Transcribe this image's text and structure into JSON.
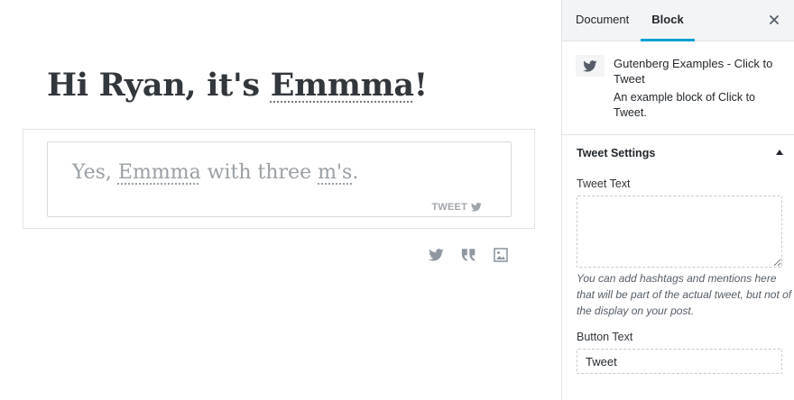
{
  "editor": {
    "title_parts": [
      "Hi Ryan, it's ",
      "Emmma",
      "!"
    ],
    "tweet_parts": [
      "Yes, ",
      "Emmma",
      " with three ",
      "m's",
      "."
    ],
    "tweet_cta": "TWEET"
  },
  "toolbar": {
    "icons": [
      "twitter-icon",
      "quote-icon",
      "image-icon"
    ]
  },
  "sidebar": {
    "tabs": {
      "document": "Document",
      "block": "Block",
      "active": "Block"
    },
    "close_icon": "close-icon",
    "block_card": {
      "icon": "twitter-icon",
      "title": "Gutenberg Examples - Click to Tweet",
      "description": "An example block of Click to Tweet."
    },
    "panel": {
      "title": "Tweet Settings",
      "expanded": true,
      "tweet_text_label": "Tweet Text",
      "tweet_text_value": "",
      "help": "You can add hashtags and mentions here that will be part of the actual tweet, but not of the display on your post.",
      "button_text_label": "Button Text",
      "button_text_value": "Tweet"
    }
  },
  "colors": {
    "accent": "#00a0d2",
    "header_bg": "#f3f4f5",
    "border": "#e2e4e7",
    "muted_text": "#9aa0a5"
  }
}
